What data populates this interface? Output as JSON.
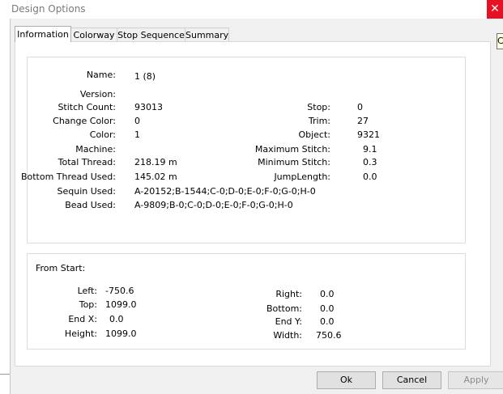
{
  "window": {
    "title": "Design Options"
  },
  "tabs": [
    {
      "label": "Information"
    },
    {
      "label": "Colorway"
    },
    {
      "label": "Stop Sequence"
    },
    {
      "label": "Summary"
    }
  ],
  "tooltip_fragment": "C",
  "info_left": [
    {
      "label": "Name:",
      "value": "1 (8)"
    },
    {
      "label": "Version:",
      "value": ""
    },
    {
      "label": "Stitch Count:",
      "value": "93013"
    },
    {
      "label": "Change Color:",
      "value": "0"
    },
    {
      "label": "Color:",
      "value": "1"
    },
    {
      "label": "Machine:",
      "value": ""
    },
    {
      "label": "Total Thread:",
      "value": "218.19 m"
    },
    {
      "label": "Bottom Thread Used:",
      "value": "145.02 m"
    },
    {
      "label": "Sequin Used:",
      "value": "A-20152;B-1544;C-0;D-0;E-0;F-0;G-0;H-0"
    },
    {
      "label": "Bead Used:",
      "value": "A-9809;B-0;C-0;D-0;E-0;F-0;G-0;H-0"
    }
  ],
  "info_right": [
    {
      "label": "Stop:",
      "value": "0"
    },
    {
      "label": "Trim:",
      "value": "27"
    },
    {
      "label": "Object:",
      "value": "9321"
    },
    {
      "label": "Maximum Stitch:",
      "value": "9.1"
    },
    {
      "label": "Minimum Stitch:",
      "value": "0.3"
    },
    {
      "label": "JumpLength:",
      "value": "0.0"
    }
  ],
  "from_start": {
    "heading": "From Start:",
    "left": [
      {
        "label": "Left:",
        "value": "-750.6"
      },
      {
        "label": "Top:",
        "value": "1099.0"
      },
      {
        "label": "End X:",
        "value": "0.0"
      },
      {
        "label": "Height:",
        "value": "1099.0"
      }
    ],
    "right": [
      {
        "label": "Right:",
        "value": "0.0"
      },
      {
        "label": "Bottom:",
        "value": "0.0"
      },
      {
        "label": "End Y:",
        "value": "0.0"
      },
      {
        "label": "Width:",
        "value": "750.6"
      }
    ]
  },
  "buttons": {
    "ok": "Ok",
    "cancel": "Cancel",
    "apply": "Apply"
  },
  "colors": {
    "close_button": "#e81123",
    "dialog_background": "#f0f0f0"
  }
}
